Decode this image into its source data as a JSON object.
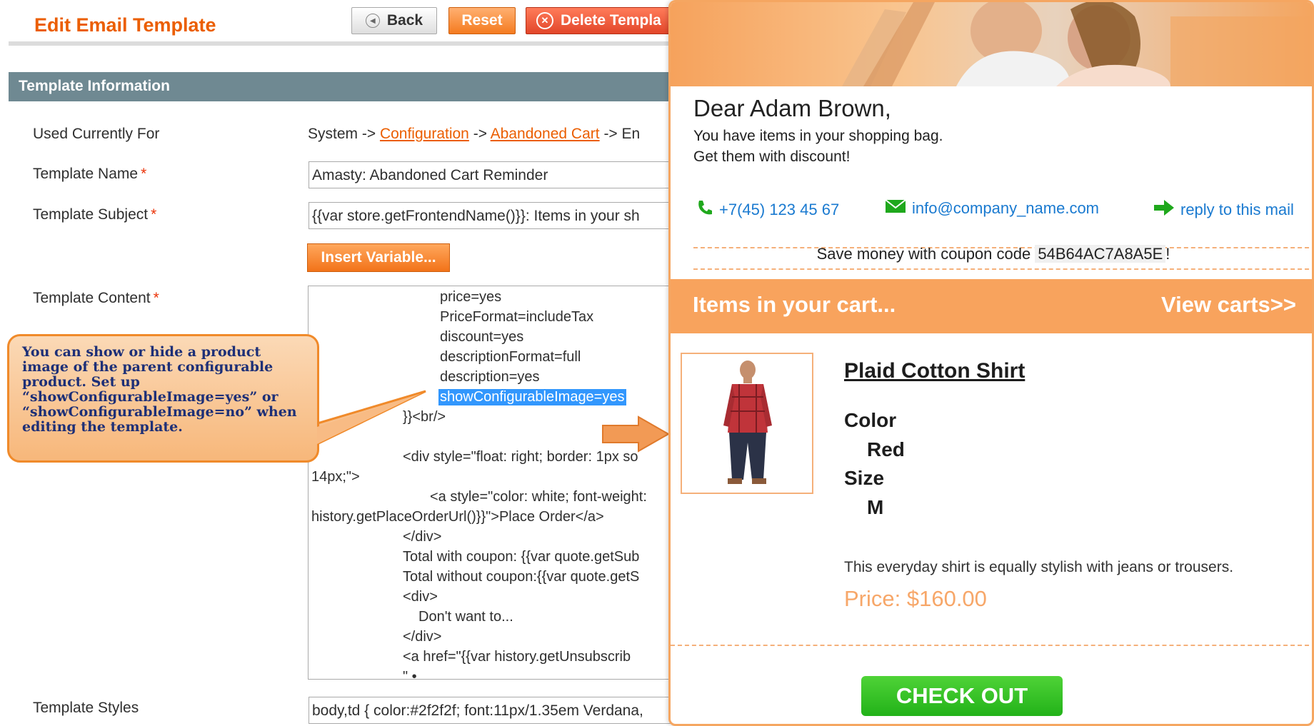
{
  "admin": {
    "page_title": "Edit Email Template",
    "buttons": {
      "back": "Back",
      "reset": "Reset",
      "delete": "Delete Templa"
    },
    "section_title": "Template Information",
    "fields": {
      "used_for_label": "Used Currently For",
      "used_for_value": {
        "prefix": "System -> ",
        "link1": "Configuration",
        "mid": " -> ",
        "link2": "Abandoned Cart",
        "suffix": " -> En"
      },
      "name_label": "Template Name",
      "name_value": "Amasty: Abandoned Cart Reminder",
      "subject_label": "Template Subject",
      "subject_value": "{{var store.getFrontendName()}}: Items in your sh",
      "insert_variable": "Insert Variable...",
      "content_label": "Template Content",
      "styles_label": "Template Styles",
      "styles_value": "body,td { color:#2f2f2f; font:11px/1.35em Verdana,",
      "required_mark": "*"
    },
    "code_lines": [
      "price=yes",
      "PriceFormat=includeTax",
      "discount=yes",
      "descriptionFormat=full",
      "description=yes",
      "showConfigurableImage=yes",
      "}}<br/>",
      "<div style=\"float: right; border: 1px so",
      "14px;\">",
      "<a style=\"color: white; font-weight:",
      "history.getPlaceOrderUrl()}}\">Place Order</a>",
      "</div>",
      "Total with coupon: {{var quote.getSub",
      "Total without coupon:{{var quote.getS",
      "<div>",
      "Don't want to...",
      "</div>",
      "<a href=\"{{var history.getUnsubscrib",
      "\" •"
    ]
  },
  "callout": {
    "text": "You can show or hide  a product image of the parent configurable product. Set up “showConfigurableImage=yes” or “showConfigurableImage=no” when editing the  template."
  },
  "email": {
    "greeting": "Dear Adam Brown,",
    "intro_line1": "You have items in your shopping bag.",
    "intro_line2": "Get them with discount!",
    "phone": "+7(45) 123 45 67",
    "email": "info@company_name.com",
    "reply": "reply to this mail",
    "coupon_text": "Save money with coupon code",
    "coupon_code": "54B64AC7A8A5E",
    "coupon_suffix": "!",
    "cart_title": "Items in your cart...",
    "view_carts": "View carts>>",
    "product": {
      "name": "Plaid Cotton Shirt",
      "color_label": "Color",
      "color_value": "Red",
      "size_label": "Size",
      "size_value": "M",
      "description": "This everyday shirt is equally stylish with jeans or trousers.",
      "price": "Price: $160.00"
    },
    "checkout": "CHECK OUT"
  },
  "colors": {
    "accent": "#eb5e00",
    "section_header": "#6f8992",
    "email_orange": "#f8a35d",
    "checkout_green": "#22b219",
    "link_blue": "#1a7ad0",
    "selection_blue": "#3297fd"
  }
}
